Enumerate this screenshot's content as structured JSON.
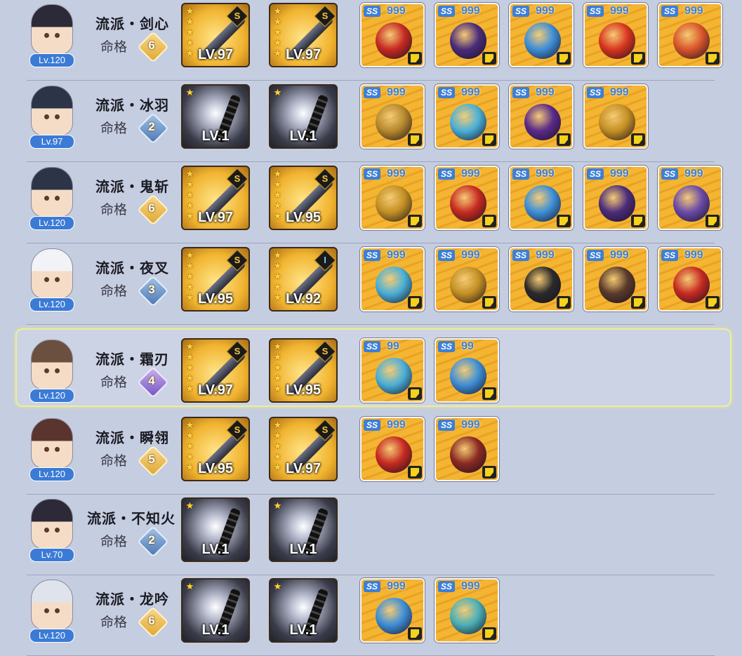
{
  "rows": [
    {
      "level": "Lv.120",
      "school": "流派・剑心",
      "fate_label": "命格",
      "fate": "6",
      "fate_color": "gold",
      "weapons": [
        {
          "level": "LV.97",
          "grade": "S",
          "stars": "★★★★★",
          "bg": "gold"
        },
        {
          "level": "LV.97",
          "grade": "S",
          "stars": "★★★★★",
          "bg": "gold"
        }
      ],
      "artifacts": [
        {
          "grade": "SS",
          "stars": "999",
          "color": "#c62a21"
        },
        {
          "grade": "SS",
          "stars": "999",
          "color": "#4b2c7a"
        },
        {
          "grade": "SS",
          "stars": "999",
          "color": "#3d8fd8"
        },
        {
          "grade": "SS",
          "stars": "999",
          "color": "#d8351f"
        },
        {
          "grade": "SS",
          "stars": "999",
          "color": "#d8552a"
        }
      ]
    },
    {
      "level": "Lv.97",
      "school": "流派・冰羽",
      "fate_label": "命格",
      "fate": "2",
      "fate_color": "blue",
      "weapons": [
        {
          "level": "LV.1",
          "grade": "",
          "stars": "★",
          "bg": "dark"
        },
        {
          "level": "LV.1",
          "grade": "",
          "stars": "★",
          "bg": "dark"
        }
      ],
      "artifacts": [
        {
          "grade": "SS",
          "stars": "999",
          "color": "#b78a2c"
        },
        {
          "grade": "SS",
          "stars": "999",
          "color": "#4ab0d8"
        },
        {
          "grade": "SS",
          "stars": "999",
          "color": "#5a2a8a"
        },
        {
          "grade": "SS",
          "stars": "999",
          "color": "#c49024"
        }
      ]
    },
    {
      "level": "Lv.120",
      "school": "流派・鬼斩",
      "fate_label": "命格",
      "fate": "6",
      "fate_color": "gold",
      "weapons": [
        {
          "level": "LV.97",
          "grade": "S",
          "stars": "★★★★★",
          "bg": "gold"
        },
        {
          "level": "LV.95",
          "grade": "S",
          "stars": "★★★★★",
          "bg": "gold"
        }
      ],
      "artifacts": [
        {
          "grade": "SS",
          "stars": "999",
          "color": "#c49024"
        },
        {
          "grade": "SS",
          "stars": "999",
          "color": "#c62a21"
        },
        {
          "grade": "SS",
          "stars": "999",
          "color": "#3d8fd8"
        },
        {
          "grade": "SS",
          "stars": "999",
          "color": "#4b2c7a"
        },
        {
          "grade": "SS",
          "stars": "999",
          "color": "#6a4aa8"
        }
      ]
    },
    {
      "level": "Lv.120",
      "school": "流派・夜叉",
      "fate_label": "命格",
      "fate": "3",
      "fate_color": "blue",
      "weapons": [
        {
          "level": "LV.95",
          "grade": "S",
          "stars": "★★★★★",
          "bg": "gold"
        },
        {
          "level": "LV.92",
          "grade": "I",
          "stars": "★★★★★",
          "bg": "gold"
        }
      ],
      "artifacts": [
        {
          "grade": "SS",
          "stars": "999",
          "color": "#4ab0d8"
        },
        {
          "grade": "SS",
          "stars": "999",
          "color": "#c49024"
        },
        {
          "grade": "SS",
          "stars": "999",
          "color": "#2a2a2a"
        },
        {
          "grade": "SS",
          "stars": "999",
          "color": "#5a3a2a"
        },
        {
          "grade": "SS",
          "stars": "999",
          "color": "#c62a21"
        }
      ]
    },
    {
      "level": "Lv.120",
      "school": "流派・霜刃",
      "fate_label": "命格",
      "fate": "4",
      "fate_color": "purple",
      "weapons": [
        {
          "level": "LV.97",
          "grade": "S",
          "stars": "★★★★★",
          "bg": "gold"
        },
        {
          "level": "LV.95",
          "grade": "S",
          "stars": "★★★★★",
          "bg": "gold"
        }
      ],
      "artifacts": [
        {
          "grade": "SS",
          "stars": "99",
          "color": "#4ab0d8"
        },
        {
          "grade": "SS",
          "stars": "99",
          "color": "#3d8fd8"
        }
      ]
    },
    {
      "level": "Lv.120",
      "school": "流派・瞬翎",
      "fate_label": "命格",
      "fate": "5",
      "fate_color": "gold",
      "weapons": [
        {
          "level": "LV.95",
          "grade": "S",
          "stars": "★★★★★",
          "bg": "gold"
        },
        {
          "level": "LV.97",
          "grade": "S",
          "stars": "★★★★★",
          "bg": "gold"
        }
      ],
      "artifacts": [
        {
          "grade": "SS",
          "stars": "999",
          "color": "#c62a21"
        },
        {
          "grade": "SS",
          "stars": "999",
          "color": "#8a2a21"
        }
      ]
    },
    {
      "level": "Lv.70",
      "school": "流派・不知火",
      "fate_label": "命格",
      "fate": "2",
      "fate_color": "blue",
      "weapons": [
        {
          "level": "LV.1",
          "grade": "",
          "stars": "★",
          "bg": "dark"
        },
        {
          "level": "LV.1",
          "grade": "",
          "stars": "★",
          "bg": "dark"
        }
      ],
      "artifacts": []
    },
    {
      "level": "Lv.120",
      "school": "流派・龙吟",
      "fate_label": "命格",
      "fate": "6",
      "fate_color": "gold",
      "weapons": [
        {
          "level": "LV.1",
          "grade": "",
          "stars": "★",
          "bg": "dark"
        },
        {
          "level": "LV.1",
          "grade": "",
          "stars": "★",
          "bg": "dark"
        }
      ],
      "artifacts": [
        {
          "grade": "SS",
          "stars": "999",
          "color": "#3d8fd8"
        },
        {
          "grade": "SS",
          "stars": "999",
          "color": "#4ab0b8"
        }
      ]
    }
  ]
}
